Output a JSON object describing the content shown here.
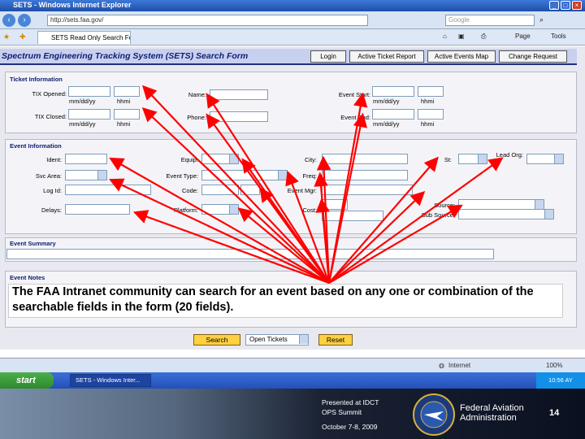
{
  "window": {
    "title": "SETS - Windows Internet Explorer"
  },
  "address": {
    "url": "http://sets.faa.gov/",
    "search_placeholder": "Google"
  },
  "tab": {
    "label": "SETS Read Only Search Form"
  },
  "toolbar": {
    "page": "Page",
    "tools": "Tools"
  },
  "app": {
    "title": "Spectrum Engineering Tracking System (SETS) Search Form",
    "buttons": [
      "Login",
      "Active Ticket Report",
      "Active Events Map",
      "Change Request"
    ]
  },
  "ticket_info": {
    "heading": "Ticket Information",
    "tix_opened": "TIX Opened:",
    "tix_closed": "TIX Closed:",
    "name": "Name:",
    "phone": "Phone:",
    "event_start": "Event Start:",
    "event_end": "Event End:",
    "date_hint": "mm/dd/yy",
    "time_hint": "hhmi"
  },
  "event_info": {
    "heading": "Event Information",
    "ident": "Ident:",
    "equip": "Equip:",
    "city": "City:",
    "st": "St:",
    "lead_org": "Lead Org:",
    "svc_area": "Svc Area:",
    "event_type": "Event Type:",
    "freq": "Freq:",
    "log_id": "Log Id:",
    "code": "Code:",
    "event_mgr": "Event Mgr:",
    "source": "Source:",
    "sub_source": "Sub Source:",
    "delays": "Delays:",
    "platform": "Platform:",
    "cost": "Cost:"
  },
  "event_summary": {
    "heading": "Event Summary"
  },
  "event_notes": {
    "heading": "Event Notes"
  },
  "callout": "The FAA Intranet community can search for an event based on any one or combination of the searchable fields in the form (20 fields).",
  "actions": {
    "search": "Search",
    "open_tickets": "Open Tickets",
    "reset": "Reset"
  },
  "status": {
    "zone": "Internet",
    "zoom": "100%"
  },
  "taskbar": {
    "start": "start",
    "task": "SETS - Windows Inter...",
    "clock": "10:56 AY"
  },
  "footer": {
    "presented_line1": "Presented at IDCT",
    "presented_line2": "OPS Summit",
    "date": "October 7-8, 2009",
    "agency_line1": "Federal Aviation",
    "agency_line2": "Administration",
    "page_number": "14"
  },
  "colors": {
    "header_bg": "#c8d0f0",
    "title": "#102070",
    "arrow": "#ff0000",
    "action_btn": "#ffd040"
  }
}
